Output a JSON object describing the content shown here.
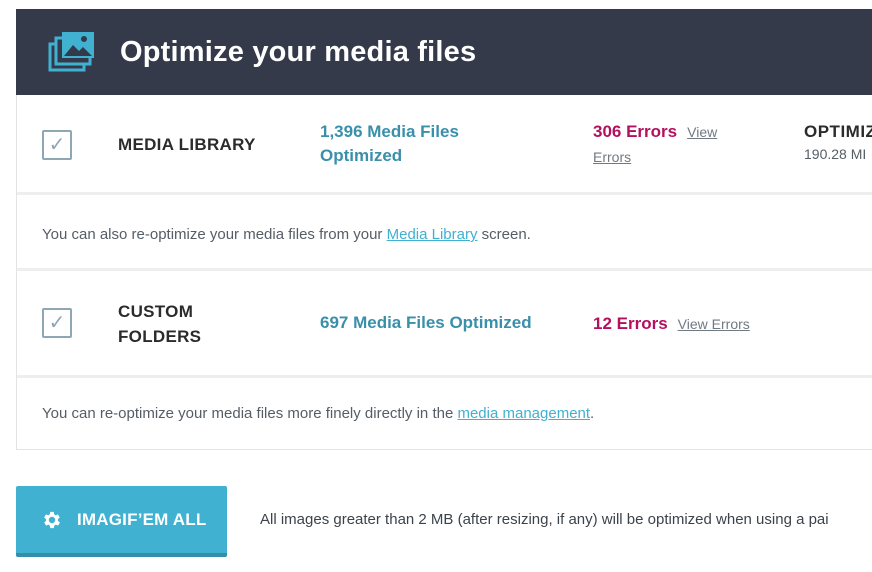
{
  "header": {
    "title": "Optimize your media files",
    "icon": "media-stack-icon"
  },
  "rows": [
    {
      "label": "MEDIA LIBRARY",
      "checked": true,
      "optimized_line1": "1,396 Media Files",
      "optimized_line2": "Optimized",
      "errors": "306 Errors",
      "view_errors_part1": "View",
      "view_errors_part2": "Errors",
      "stats_title": "OPTIMIZ",
      "stats_size": "190.28 MI"
    },
    {
      "label_line1": "CUSTOM",
      "label_line2": "FOLDERS",
      "checked": true,
      "optimized": "697 Media Files Optimized",
      "errors": "12 Errors",
      "view_errors": "View Errors"
    }
  ],
  "notes": {
    "library_prefix": "You can also re-optimize your media files from your ",
    "library_link": "Media Library",
    "library_suffix": " screen.",
    "folders_prefix": "You can re-optimize your media files more finely directly in the ",
    "folders_link": "media management",
    "folders_suffix": "."
  },
  "action": {
    "button_label": "IMAGIF’EM ALL",
    "button_icon": "gear-icon",
    "note": "All images greater than 2 MB (after resizing, if any) will be optimized when using a pai"
  },
  "colors": {
    "header_bg": "#343a4a",
    "accent": "#40b1d0",
    "optimized_text": "#3a8faa",
    "errors_text": "#b3105f"
  }
}
